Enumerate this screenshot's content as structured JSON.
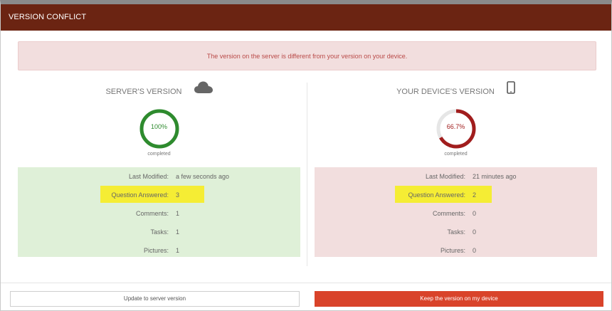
{
  "dialog": {
    "title": "VERSION CONFLICT",
    "alert": "The version on the server is different from your version on your device."
  },
  "server": {
    "heading": "SERVER'S VERSION",
    "icon": "cloud-icon",
    "progress_percent": 100,
    "progress_label": "100%",
    "completed_label": "completed",
    "ring_color": "#2e8b2e",
    "stats": [
      {
        "label": "Last Modified:",
        "value": "a few seconds ago"
      },
      {
        "label": "Question Answered:",
        "value": "3"
      },
      {
        "label": "Comments:",
        "value": "1"
      },
      {
        "label": "Tasks:",
        "value": "1"
      },
      {
        "label": "Pictures:",
        "value": "1"
      }
    ]
  },
  "device": {
    "heading": "YOUR DEVICE'S VERSION",
    "icon": "mobile-phone-icon",
    "progress_percent": 66.7,
    "progress_label": "66.7%",
    "completed_label": "completed",
    "ring_color": "#a11d1d",
    "stats": [
      {
        "label": "Last Modified:",
        "value": "21 minutes ago"
      },
      {
        "label": "Question Answered:",
        "value": "2"
      },
      {
        "label": "Comments:",
        "value": "0"
      },
      {
        "label": "Tasks:",
        "value": "0"
      },
      {
        "label": "Pictures:",
        "value": "0"
      }
    ]
  },
  "buttons": {
    "update": "Update to server version",
    "keep": "Keep the version on my device"
  },
  "colors": {
    "titlebar": "#6b2412",
    "primary_button": "#d9432a",
    "highlight": "#f5ed34"
  }
}
